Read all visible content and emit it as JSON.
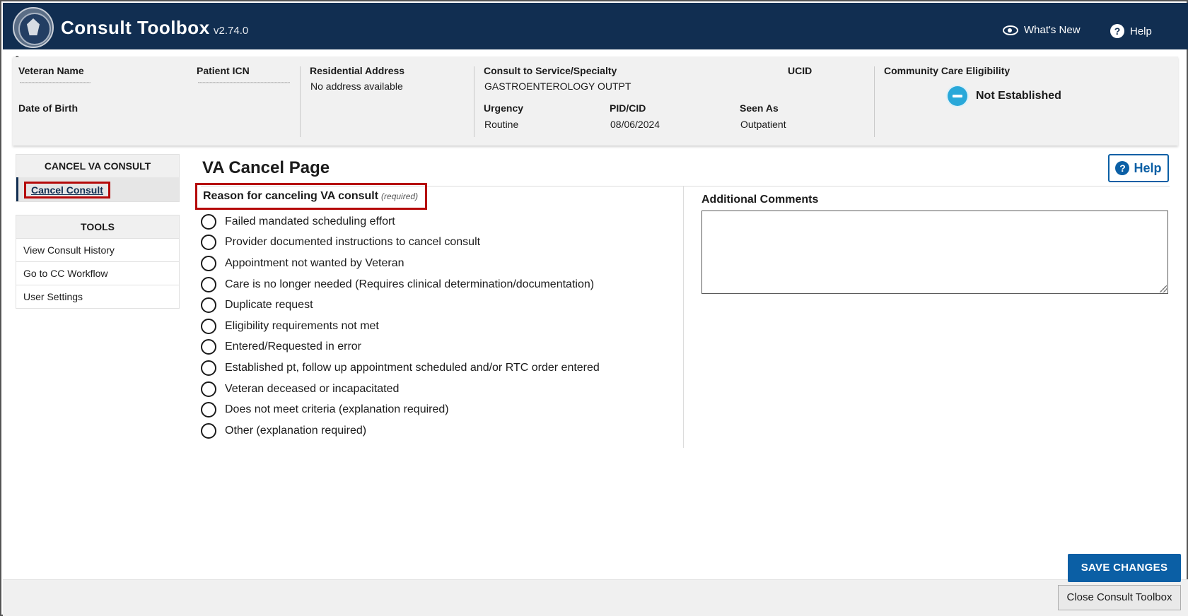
{
  "app": {
    "title": "Consult Toolbox",
    "version": "v2.74.0",
    "whats_new": "What's New",
    "help": "Help"
  },
  "banner": {
    "veteran_name_label": "Veteran Name",
    "patient_icn_label": "Patient ICN",
    "dob_label": "Date of Birth",
    "address_label": "Residential Address",
    "address_value": "No address available",
    "service_label": "Consult to Service/Specialty",
    "service_value": "GASTROENTEROLOGY OUTPT",
    "ucid_label": "UCID",
    "urgency_label": "Urgency",
    "urgency_value": "Routine",
    "pidcid_label": "PID/CID",
    "pidcid_value": "08/06/2024",
    "seen_as_label": "Seen As",
    "seen_as_value": "Outpatient",
    "cce_label": "Community Care Eligibility",
    "cce_value": "Not Established"
  },
  "sidebar": {
    "cancel_header": "CANCEL VA CONSULT",
    "cancel_link": "Cancel Consult",
    "tools_header": "TOOLS",
    "tools": [
      "View Consult History",
      "Go to CC Workflow",
      "User Settings"
    ]
  },
  "main": {
    "page_title": "VA Cancel Page",
    "help_button": "Help",
    "reason_label": "Reason for canceling VA consult",
    "reason_required": "(required)",
    "reasons": [
      "Failed mandated scheduling effort",
      "Provider documented instructions to cancel consult",
      "Appointment not wanted by Veteran",
      "Care is no longer needed (Requires clinical determination/documentation)",
      "Duplicate request",
      "Eligibility requirements not met",
      "Entered/Requested in error",
      "Established pt, follow up appointment scheduled and/or RTC order entered",
      "Veteran deceased or incapacitated",
      "Does not meet criteria (explanation required)",
      "Other (explanation required)"
    ],
    "comments_label": "Additional Comments",
    "comments_value": ""
  },
  "footer": {
    "save_button": "SAVE CHANGES",
    "close_button": "Close Consult Toolbox"
  },
  "colors": {
    "header_bg": "#112e51",
    "primary_blue": "#0b5fa5",
    "highlight_red": "#b50909",
    "eligibility_icon": "#29a8d9"
  }
}
